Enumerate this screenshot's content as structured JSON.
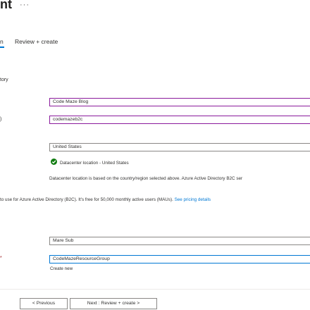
{
  "header": {
    "title": "nt",
    "ellipsis": "···"
  },
  "tabs": [
    {
      "label": "n"
    },
    {
      "label": "Review + create"
    }
  ],
  "form": {
    "section_label": "tory",
    "org_name": {
      "value": "Code Maze Blog"
    },
    "domain_name": {
      "label_fragment": ")",
      "value": "codemazeb2c"
    },
    "country": {
      "value": "United States"
    },
    "datacenter_status": "Datacenter location - United States",
    "datacenter_note": "Datacenter location is based on the country/region selected above. Azure Active Directory B2C ser",
    "subscription_note": "to use for Azure Active Directory (B2C). It's free for 50,000 monthly active users (MAUs).",
    "pricing_link": "See pricing details",
    "subscription": {
      "value": "Mare Sub"
    },
    "resource_group": {
      "required_mark": "*",
      "value": "CodeMazeResourceGroup"
    },
    "create_new_link": "Create new"
  },
  "footer": {
    "previous_label": "< Previous",
    "next_label": "Next : Review + create >"
  },
  "colors": {
    "accent": "#0078d4",
    "success": "#107c10",
    "focus_border": "#8a1a9c"
  }
}
